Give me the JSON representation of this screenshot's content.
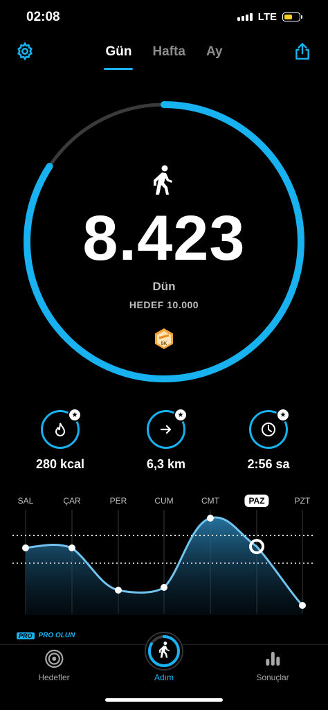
{
  "status": {
    "time": "02:08",
    "network": "LTE"
  },
  "tabs": [
    "Gün",
    "Hafta",
    "Ay"
  ],
  "active_tab": "Gün",
  "icons": {
    "settings": "gear-icon",
    "share": "share-icon",
    "walker": "walking-icon",
    "badge": "5k-badge-icon"
  },
  "summary": {
    "steps": "8.423",
    "day_label": "Dün",
    "goal_label": "HEDEF 10.000",
    "progress": 0.8423,
    "badge_text": "5K"
  },
  "stats": [
    {
      "icon": "flame-icon",
      "value": "280 kcal"
    },
    {
      "icon": "arrow-right-icon",
      "value": "6,3 km"
    },
    {
      "icon": "clock-icon",
      "value": "2:56 sa"
    }
  ],
  "week": {
    "days": [
      "SAL",
      "ÇAR",
      "PER",
      "CUM",
      "CMT",
      "PAZ",
      "PZT"
    ],
    "selected": "PAZ"
  },
  "pro": {
    "tag": "PRO",
    "label": "PRO OLUN"
  },
  "nav": [
    {
      "label": "Hedefler",
      "icon": "target-icon"
    },
    {
      "label": "Adım",
      "icon": "walking-icon"
    },
    {
      "label": "Sonuçlar",
      "icon": "bar-chart-icon"
    }
  ],
  "colors": {
    "accent": "#17b2ef",
    "track": "#3a3a3a",
    "background": "#000000"
  }
}
